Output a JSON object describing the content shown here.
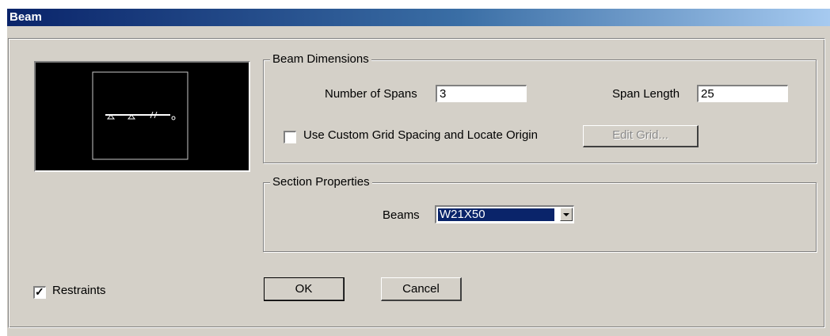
{
  "window": {
    "title": "Beam"
  },
  "beam_dimensions": {
    "legend": "Beam Dimensions",
    "num_spans_label": "Number of Spans",
    "num_spans_value": "3",
    "span_length_label": "Span Length",
    "span_length_value": "25",
    "custom_grid_label": "Use Custom Grid Spacing and Locate Origin",
    "custom_grid_checked": false,
    "edit_grid_label": "Edit Grid..."
  },
  "section_properties": {
    "legend": "Section Properties",
    "beams_label": "Beams",
    "beams_value": "W21X50"
  },
  "restraints": {
    "label": "Restraints",
    "checked": true
  },
  "buttons": {
    "ok": "OK",
    "cancel": "Cancel"
  },
  "icons": {
    "preview": "beam-preview-icon",
    "dropdown": "chevron-down-icon",
    "check": "checkmark-icon"
  }
}
